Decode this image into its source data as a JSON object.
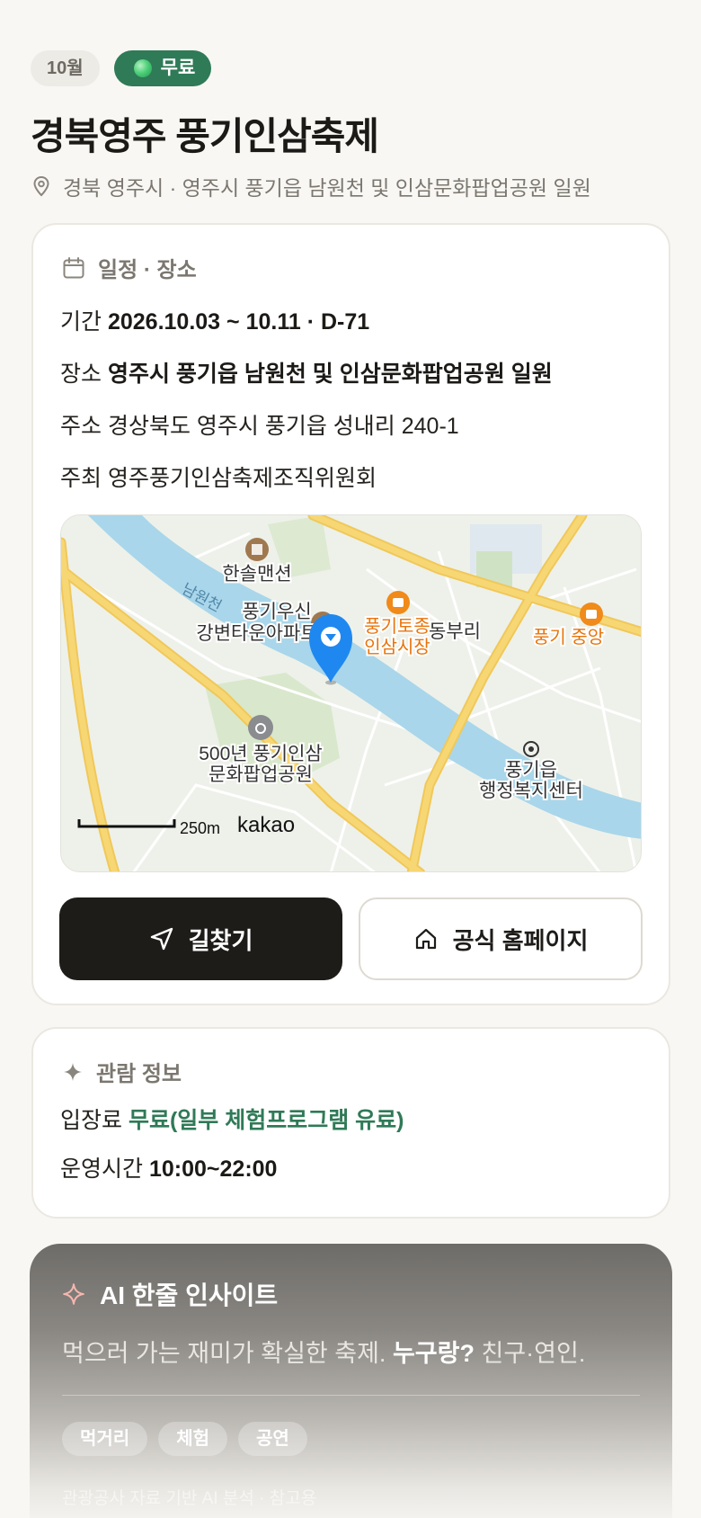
{
  "header": {
    "month_chip": "10월",
    "free_chip": "무료",
    "title": "경북영주 풍기인삼축제",
    "location": "경북 영주시 · 영주시 풍기읍 남원천 및 인삼문화팝업공원 일원"
  },
  "schedule": {
    "section_title": "일정 · 장소",
    "period_label": "기간",
    "period_value": "2026.10.03 ~ 10.11 · D-71",
    "place_label": "장소",
    "place_value": "영주시 풍기읍 남원천 및 인삼문화팝업공원 일원",
    "address_label": "주소",
    "address_value": "경상북도 영주시 풍기읍 성내리 240-1",
    "host_label": "주최",
    "host_value": "영주풍기인삼축제조직위원회",
    "map": {
      "labels": {
        "mansion": "한솔맨션",
        "stream": "남원천",
        "apt_line1": "풍기우신",
        "apt_line2": "강변타운아파트",
        "market_line1": "풍기토종",
        "market_line2": "인삼시장",
        "village": "동부리",
        "market_right": "풍기 중앙",
        "park_line1": "500년 풍기인삼",
        "park_line2": "문화팝업공원",
        "office_line1": "풍기읍",
        "office_line2": "행정복지센터",
        "scale": "250m",
        "logo": "kakao"
      }
    },
    "directions_button": "길찾기",
    "homepage_button": "공식 홈페이지"
  },
  "info": {
    "section_title": "관람 정보",
    "fee_label": "입장료",
    "fee_value": "무료(일부 체험프로그램 유료)",
    "hours_label": "운영시간",
    "hours_value": "10:00~22:00"
  },
  "ai": {
    "title": "AI 한줄 인사이트",
    "text_main": "먹으러 가는 재미가 확실한 축제.",
    "text_who": "누구랑?",
    "text_tail": "친구·연인.",
    "tags": [
      "먹거리",
      "체험",
      "공연"
    ],
    "footnote": "관광공사 자료 기반 AI 분석 · 참고용"
  },
  "colors": {
    "accent_green": "#2f7a57",
    "dark_button": "#1e1c19",
    "pin_blue": "#1e88f0",
    "road_yellow": "#f7d774",
    "river_blue": "#a9d6ea"
  }
}
